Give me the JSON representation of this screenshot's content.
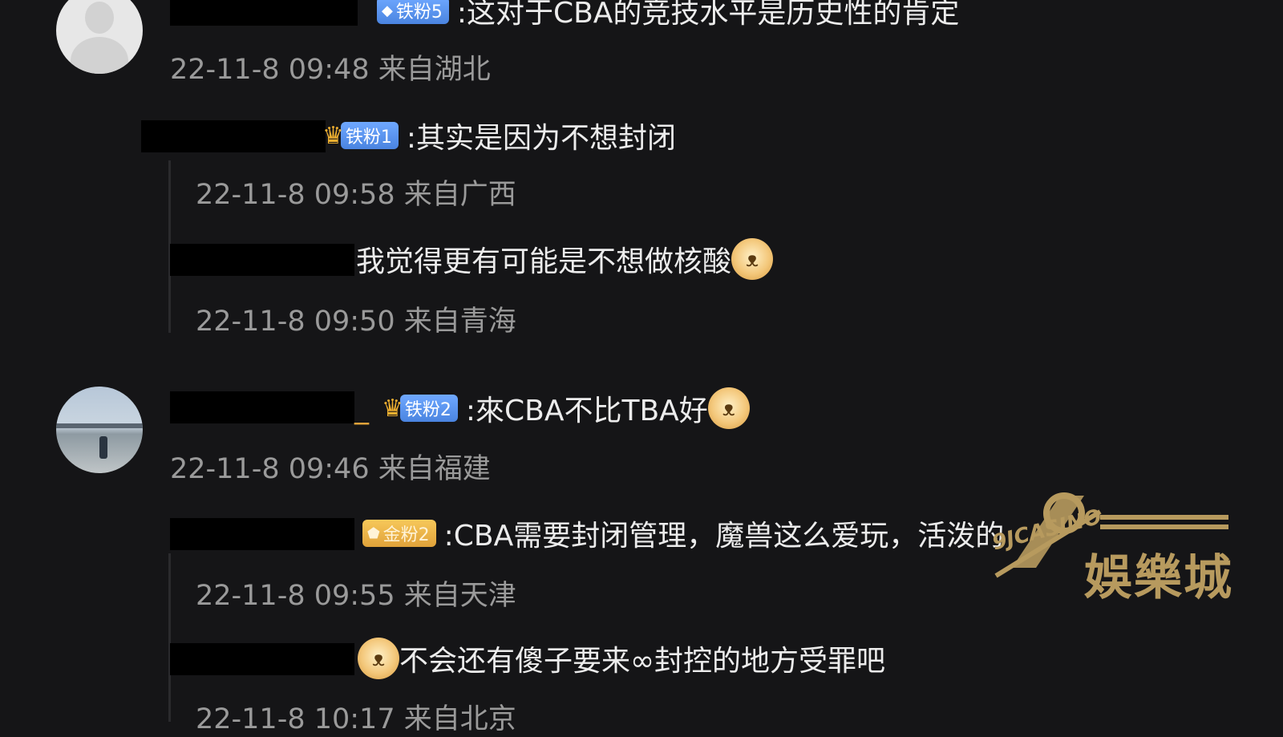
{
  "comments": [
    {
      "badge": "铁粉5",
      "badge_icon": "diamond",
      "text": ":这对于CBA的竞技水平是历史性的肯定",
      "meta": "22-11-8 09:48 来自湖北"
    },
    {
      "badge": "铁粉1",
      "badge_icon": "crown",
      "text": ":其实是因为不想封闭",
      "meta": "22-11-8 09:58 来自广西"
    },
    {
      "text": "我觉得更有可能是不想做核酸",
      "emoji": "doge",
      "meta": "22-11-8 09:50 来自青海"
    },
    {
      "suffix": "_",
      "badge": "铁粉2",
      "badge_icon": "crown",
      "text": ":來CBA不比TBA好",
      "emoji": "doge",
      "meta": "22-11-8 09:46 来自福建"
    },
    {
      "badge": "金粉2",
      "badge_icon": "gold-medal",
      "text": ":CBA需要封闭管理，魔兽这么爱玩，活泼的",
      "meta": "22-11-8 09:55 来自天津"
    },
    {
      "emoji": "doge",
      "text": "不会还有傻子要来∞封控的地方受罪吧",
      "meta": "22-11-8 10:17 来自北京"
    }
  ],
  "watermark": {
    "brand": "娛樂城",
    "casino": "9JCASINO"
  },
  "colors": {
    "background": "#151517",
    "meta_text": "#9a9a9a",
    "badge_blue": "#5a95f0",
    "badge_gold": "#e8b048",
    "watermark": "#b79a5e"
  }
}
